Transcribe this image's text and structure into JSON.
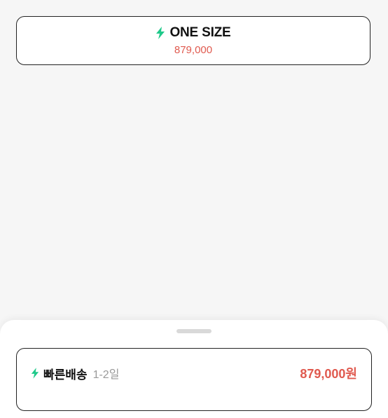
{
  "size_option": {
    "label": "ONE SIZE",
    "price": "879,000",
    "icon": "lightning-bolt-icon"
  },
  "delivery_sheet": {
    "option": {
      "label": "빠른배송",
      "eta": "1-2일",
      "price": "879,000원",
      "icon": "lightning-bolt-icon"
    }
  },
  "colors": {
    "accent_green": "#1fc98a",
    "price_red": "#e05a4f",
    "border": "#222222"
  }
}
